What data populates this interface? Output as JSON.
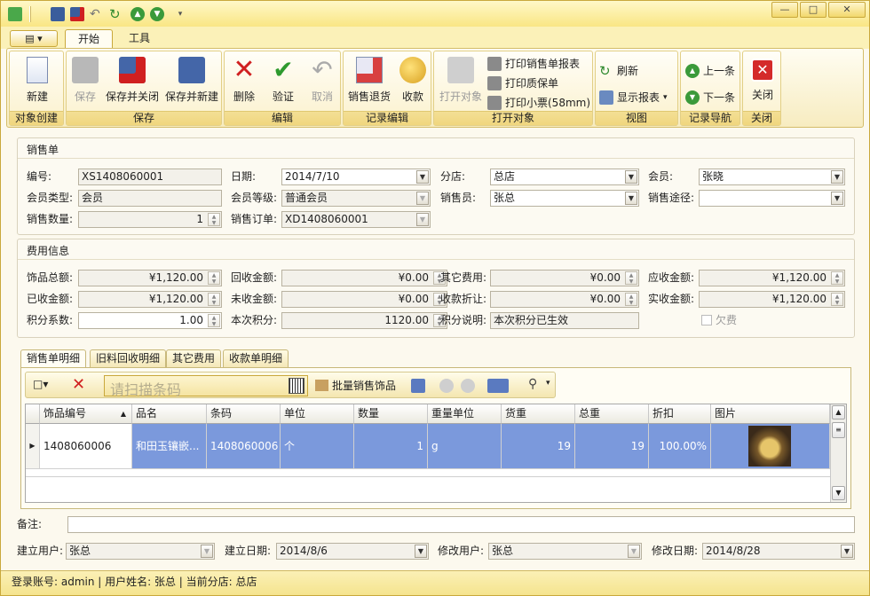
{
  "ribbon_tabs": [
    "开始",
    "工具"
  ],
  "groups": {
    "create": {
      "label": "对象创建",
      "new": "新建"
    },
    "save": {
      "label": "保存",
      "save": "保存",
      "save_close": "保存并关闭",
      "save_new": "保存并新建"
    },
    "edit": {
      "label": "编辑",
      "delete": "删除",
      "verify": "验证",
      "cancel": "取消"
    },
    "record_edit": {
      "label": "记录编辑",
      "return": "销售退货",
      "collect": "收款"
    },
    "open": {
      "label": "打开对象",
      "open_obj": "打开对象",
      "print_sales": "打印销售单报表",
      "print_warranty": "打印质保单",
      "print_receipt": "打印小票(58mm)"
    },
    "view": {
      "label": "视图",
      "refresh": "刷新",
      "show_report": "显示报表"
    },
    "nav": {
      "label": "记录导航",
      "prev": "上一条",
      "next": "下一条"
    },
    "close": {
      "label": "关闭",
      "close": "关闭"
    }
  },
  "sales": {
    "section": "销售单",
    "no_label": "编号:",
    "no": "XS1408060001",
    "date_label": "日期:",
    "date": "2014/7/10",
    "branch_label": "分店:",
    "branch": "总店",
    "member_label": "会员:",
    "member": "张晓",
    "member_type_label": "会员类型:",
    "member_type": "会员",
    "member_level_label": "会员等级:",
    "member_level": "普通会员",
    "salesperson_label": "销售员:",
    "salesperson": "张总",
    "channel_label": "销售途径:",
    "channel": "",
    "qty_label": "销售数量:",
    "qty": "1",
    "order_label": "销售订单:",
    "order": "XD1408060001"
  },
  "fees": {
    "section": "费用信息",
    "jewelry_total_label": "饰品总额:",
    "jewelry_total": "¥1,120.00",
    "recycle_label": "回收金额:",
    "recycle": "¥0.00",
    "other_label": "其它费用:",
    "other": "¥0.00",
    "receivable_label": "应收金额:",
    "receivable": "¥1,120.00",
    "received_label": "已收金额:",
    "received": "¥1,120.00",
    "unreceived_label": "未收金额:",
    "unreceived": "¥0.00",
    "discount_label": "收款折让:",
    "discount": "¥0.00",
    "actual_label": "实收金额:",
    "actual": "¥1,120.00",
    "points_coef_label": "积分系数:",
    "points_coef": "1.00",
    "points_label": "本次积分:",
    "points": "1120.00",
    "points_desc_label": "积分说明:",
    "points_desc": "本次积分已生效",
    "owe_label": "欠费"
  },
  "detail_tabs": [
    "销售单明细",
    "旧料回收明细",
    "其它费用",
    "收款单明细"
  ],
  "detail_toolbar": {
    "barcode_placeholder": "请扫描条码",
    "batch_sale": "批量销售饰品"
  },
  "table": {
    "columns": [
      "饰品编号",
      "品名",
      "条码",
      "单位",
      "数量",
      "重量单位",
      "货重",
      "总重",
      "折扣",
      "图片"
    ],
    "rows": [
      [
        "1408060006",
        "和田玉镶嵌...",
        "1408060006",
        "个",
        "1",
        "g",
        "19",
        "19",
        "100.00%",
        ""
      ]
    ]
  },
  "footer": {
    "remark_label": "备注:",
    "remark": "",
    "creator_label": "建立用户:",
    "creator": "张总",
    "created_label": "建立日期:",
    "created": "2014/8/6",
    "modifier_label": "修改用户:",
    "modifier": "张总",
    "modified_label": "修改日期:",
    "modified": "2014/8/28"
  },
  "status": {
    "text": "登录账号: admin | 用户姓名: 张总 | 当前分店: 总店"
  },
  "colors": {
    "accent": "#f9e684",
    "selection": "#7b99dc",
    "delete_red": "#d02020",
    "ok_green": "#2e9a2e"
  }
}
